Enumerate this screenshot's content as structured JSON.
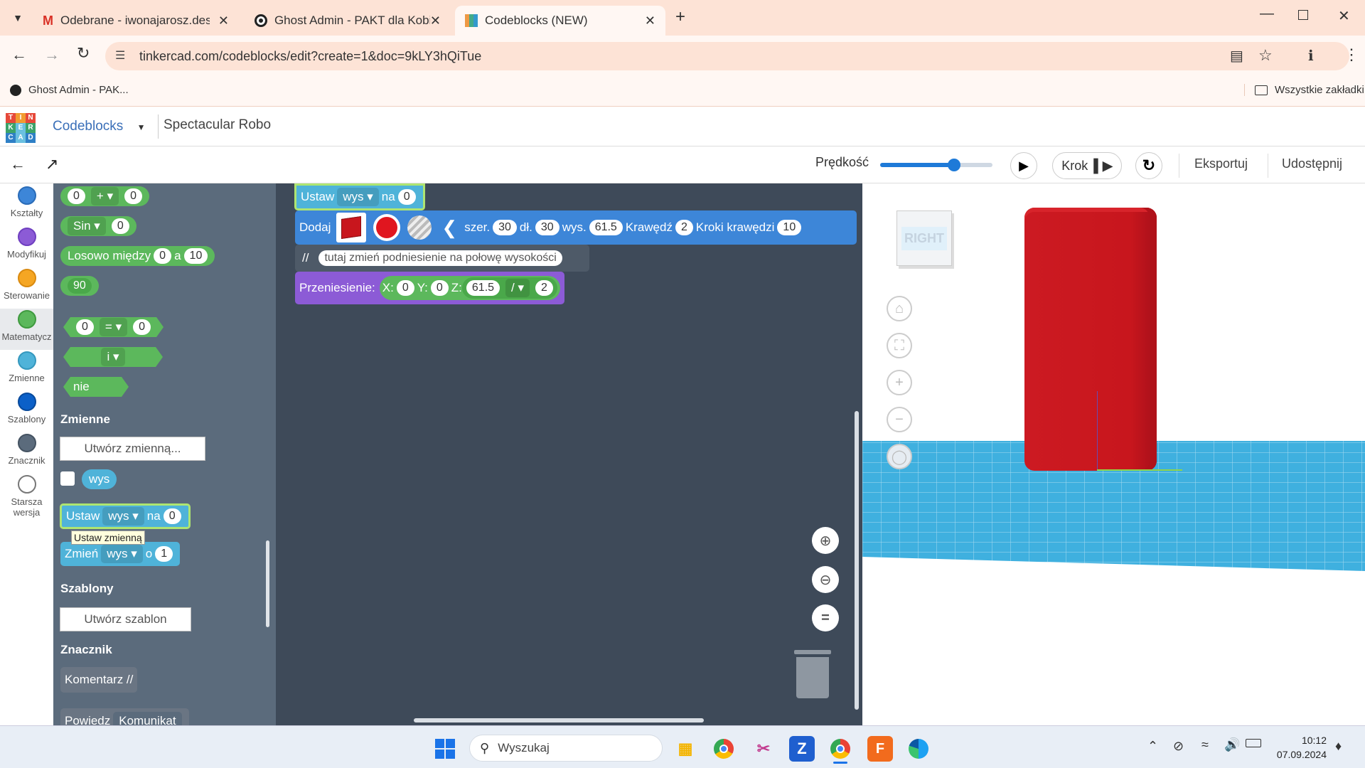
{
  "browser": {
    "tabs": [
      {
        "title": "Odebrane - iwonajarosz.design",
        "icon": "gmail-icon"
      },
      {
        "title": "Ghost Admin - PAKT dla Kobiet",
        "icon": "ghost-icon"
      },
      {
        "title": "Codeblocks (NEW)",
        "icon": "tinkercad-icon"
      }
    ],
    "url": "tinkercad.com/codeblocks/edit?create=1&doc=9kLY3hQiTue",
    "bookmark": "Ghost Admin - PAK...",
    "all_bookmarks": "Wszystkie zakładki"
  },
  "app": {
    "logo": [
      "T",
      "I",
      "N",
      "K",
      "E",
      "R",
      "C",
      "A",
      "D"
    ],
    "menu": "Codeblocks",
    "project": "Spectacular Robo"
  },
  "toolbar": {
    "speed_label": "Prędkość",
    "speed": 0.66,
    "step": "Krok",
    "export": "Eksportuj",
    "share": "Udostępnij"
  },
  "categories": [
    {
      "label": "Kształty",
      "color": "#3d86d8"
    },
    {
      "label": "Modyfikuj",
      "color": "#8c5bd6"
    },
    {
      "label": "Sterowanie",
      "color": "#f5a623"
    },
    {
      "label": "Matematycz",
      "color": "#5cb85c"
    },
    {
      "label": "Zmienne",
      "color": "#4fb3d9"
    },
    {
      "label": "Szablony",
      "color": "#0b60c8"
    },
    {
      "label": "Znacznik",
      "color": "#5b6b7c"
    },
    {
      "label": "Starsza wersja",
      "color": "#ffffff"
    }
  ],
  "flyout": {
    "math_add": {
      "a": "0",
      "op": "+",
      "b": "0"
    },
    "sin": {
      "fn": "Sin",
      "v": "0"
    },
    "random": {
      "label": "Losowo między",
      "a": "0",
      "and": "a",
      "b": "10"
    },
    "number": "90",
    "compare": {
      "a": "0",
      "op": "=",
      "b": "0"
    },
    "logic": {
      "op": "i"
    },
    "not": "nie",
    "variables_header": "Zmienne",
    "create_var": "Utwórz zmienną...",
    "var_name": "wys",
    "set_block": {
      "label": "Ustaw",
      "var": "wys",
      "to": "na",
      "value": "0"
    },
    "tooltip": "Ustaw zmienną",
    "change_block": {
      "label": "Zmień",
      "var": "wys",
      "by": "o",
      "value": "1"
    },
    "templates_header": "Szablony",
    "create_template": "Utwórz szablon",
    "marker_header": "Znacznik",
    "comment_block": "Komentarz //",
    "say_block": {
      "label": "Powiedz",
      "msg": "Komunikat"
    }
  },
  "workspace": {
    "set": {
      "label": "Ustaw",
      "var": "wys",
      "to": "na",
      "value": "0"
    },
    "add": {
      "label": "Dodaj",
      "width_label": "szer.",
      "width": "30",
      "len_label": "dł.",
      "len": "30",
      "height_label": "wys.",
      "height": "61.5",
      "edge_label": "Krawędź",
      "edge": "2",
      "steps_label": "Kroki krawędzi",
      "steps": "10"
    },
    "comment": {
      "slashes": "//",
      "text": "tutaj zmień podniesienie na połowę wysokości"
    },
    "move": {
      "label": "Przeniesienie:",
      "x_label": "X:",
      "x": "0",
      "y_label": "Y:",
      "y": "0",
      "z_label": "Z:",
      "z": "61.5",
      "op": "/",
      "div": "2"
    }
  },
  "viewport": {
    "cube_face": "RIGHT",
    "shape_color": "#c8161d"
  },
  "taskbar": {
    "search": "Wyszukaj",
    "time": "10:12",
    "date": "07.09.2024"
  }
}
